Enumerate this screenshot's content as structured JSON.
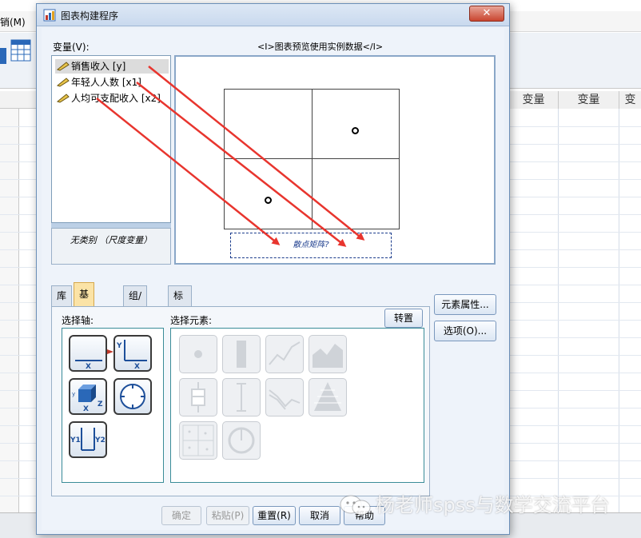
{
  "background": {
    "menu_item": "销(M)",
    "column_headers": [
      "变量",
      "变量",
      "变"
    ]
  },
  "dialog": {
    "title": "图表构建程序",
    "close_label": "✕",
    "variables_label": "变量(V):",
    "preview_label": "<I>图表预览使用实例数据</I>",
    "variables": [
      {
        "label": "销售收入 [y]",
        "selected": true
      },
      {
        "label": "年轻人人数 [x1]",
        "selected": false
      },
      {
        "label": "人均可支配收入 [x2]",
        "selected": false
      }
    ],
    "category_text": "无类别 （尺度变量）",
    "drop_zone_text": "散点矩阵?",
    "tabs": [
      "库",
      "基本元素",
      "组/点 ID",
      "标题/脚注"
    ],
    "active_tab": "基本元素",
    "axis_label": "选择轴:",
    "elements_label": "选择元素:",
    "transpose_label": "转置",
    "element_properties_label": "元素属性...",
    "options_label": "选项(O)...",
    "buttons": {
      "ok": "确定",
      "paste": "粘贴(P)",
      "reset": "重置(R)",
      "cancel": "取消",
      "help": "帮助"
    }
  },
  "watermark": "杨老师spss与数学交流平台",
  "colors": {
    "arrow": "#e8352e",
    "active_tab": "#fbe3a6",
    "accent_border": "#3a8c98"
  }
}
